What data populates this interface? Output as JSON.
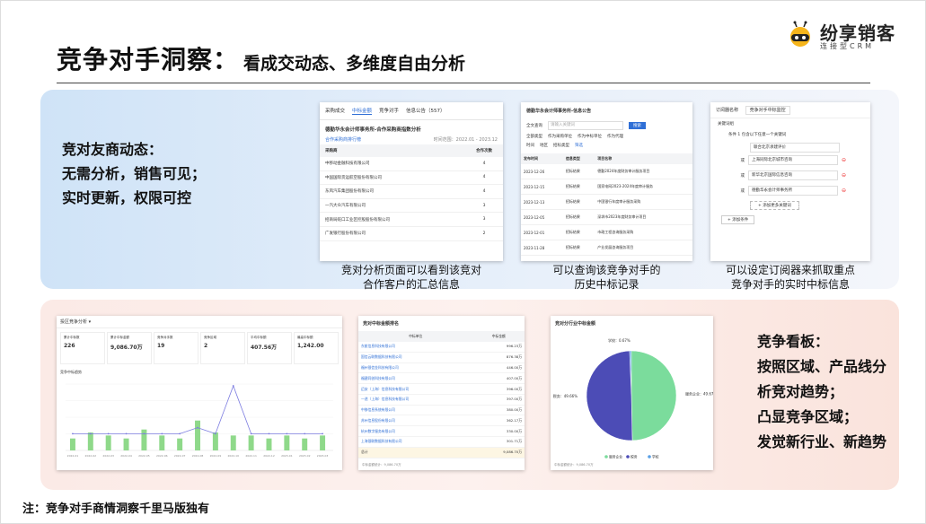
{
  "header": {
    "title": "竞争对手洞察：",
    "subtitle": "看成交动态、多维度自由分析"
  },
  "logo": {
    "name": "纷享销客",
    "tagline": "连接型CRM",
    "icon": "bee-logo-icon"
  },
  "top_section": {
    "blurb": [
      "竞对友商动态：",
      "无需分析，销售可见；",
      "实时更新，权限可控"
    ],
    "captions": [
      [
        "竞对分析页面可以看到该竞对",
        "合作客户的汇总信息"
      ],
      [
        "可以查询该竞争对手的",
        "历史中标记录"
      ],
      [
        "可以设定订阅器来抓取重点",
        "竞争对手的实时中标信息"
      ]
    ]
  },
  "bottom_section": {
    "blurb": [
      "竞争看板：",
      "按照区域、产品线分",
      "析竞对趋势；",
      "凸显竞争区域；",
      "发觉新行业、新趋势"
    ]
  },
  "footer_note": "注：竞争对手商情洞察千里马版独有",
  "shot1": {
    "tabs": [
      "采购成交",
      "中标金额",
      "竞争对手",
      "信息公告（557）"
    ],
    "active_tab": 1,
    "heading": "德勤华永会计师事务所-合作采购商指数分析",
    "subhead_left": "合作采购商排行榜",
    "subhead_right": "时间范围：2022.01 - 2023.12",
    "columns": [
      "采购商",
      "合作次数"
    ],
    "rows": [
      [
        "中移动金融科技有限公司",
        "4"
      ],
      [
        "中国国际货运航空股份有限公司",
        "4"
      ],
      [
        "东风汽车集团股份有限公司",
        "4"
      ],
      [
        "一汽大众汽车有限公司",
        "3"
      ],
      [
        "招商局蛇口工业区控股股份有限公司",
        "3"
      ],
      [
        "广发银行股份有限公司",
        "2"
      ]
    ]
  },
  "shot2": {
    "heading": "德勤华永会计师事务所-信息公告",
    "search_label": "全文查询",
    "search_placeholder": "请输入关键词",
    "search_button": "搜索",
    "filters": [
      "全部类型",
      "作为采购单位",
      "作为中标单位",
      "作为代理"
    ],
    "filters2": [
      "时间",
      "地区",
      "招标类型",
      "筛选"
    ],
    "columns": [
      "发布时间",
      "信息类型",
      "项目名称"
    ],
    "rows": [
      [
        "2023-12-26",
        "招标结果",
        "德勤2024年度财务审计服务项目"
      ],
      [
        "2023-12-15",
        "招标结果",
        "国家电网2023-2024年度审计服务"
      ],
      [
        "2023-12-13",
        "招标结果",
        "中国银行年度审计服务采购"
      ],
      [
        "2023-12-05",
        "招标结果",
        "深圳市2023年度财务审计项目"
      ],
      [
        "2023-12-01",
        "招标结果",
        "市政工程咨询服务采购"
      ],
      [
        "2023-11-28",
        "招标结果",
        "产业发展咨询服务项目"
      ]
    ]
  },
  "shot3": {
    "heading": "订阅器名称",
    "heading_value": "竞争对手中标监控",
    "line1": "关键词组",
    "line2": "条件 1 包含以下任意一个关键词",
    "inputs": [
      "联合北京承建评价",
      "上海同际北京城市咨询",
      "新华北京国际信息咨询",
      "德勤华永会计师事务所"
    ],
    "or_label": "或",
    "add_group": "添加更多关键词",
    "add_condition": "添加条件"
  },
  "shot4": {
    "title": "投区竞争分析",
    "kpis": [
      {
        "label": "累计中标数",
        "value": "226"
      },
      {
        "label": "累计中标金额",
        "value": "9,086.70万"
      },
      {
        "label": "竞争对手数",
        "value": "19"
      },
      {
        "label": "竞争区域",
        "value": "2"
      },
      {
        "label": "平均中标额",
        "value": "407.56万"
      },
      {
        "label": "最高中标额",
        "value": "1,242.00"
      }
    ],
    "chart_title": "竞争中标趋势"
  },
  "shot5": {
    "title": "竞对中标金额排名",
    "columns": [
      "中标单位",
      "中标金额"
    ],
    "rows": [
      [
        "东航信息科技有限公司",
        "996.23万"
      ],
      [
        "国信云联数据科技有限公司",
        "876.38万"
      ],
      [
        "福州银信金科技有限公司",
        "446.00万"
      ],
      [
        "福建同创科技有限公司",
        "407.00万"
      ],
      [
        "迈安（上海）信息科技有限公司",
        "396.00万"
      ],
      [
        "一途（上海）信息科技有限公司",
        "397.00万"
      ],
      [
        "中移信息系统有限公司",
        "380.00万"
      ],
      [
        "苏州信息股份有限公司",
        "362.17万"
      ],
      [
        "杭州数字服务有限公司",
        "330.00万"
      ],
      [
        "上海银联数据科技有限公司",
        "301.71万"
      ]
    ],
    "total_label": "总计",
    "total_value": "9,086.70万",
    "footer": "中标金额统计：9,086.70万"
  },
  "shot6": {
    "title": "竞对分行业中标金额",
    "footer": "中标金额统计：9,086.70万",
    "legend": [
      "服务企业",
      "税务",
      "学校"
    ]
  },
  "chart_data": [
    {
      "type": "pie",
      "title": "竞对分行业中标金额",
      "categories": [
        "服务企业",
        "税务",
        "学校"
      ],
      "values": [
        49.67,
        49.66,
        0.67
      ],
      "labels": [
        "服务企业：49.67%",
        "税务：49.66%",
        "学校：0.67%"
      ],
      "colors": [
        "#7bdc9c",
        "#4c4cb6",
        "#5aa0e6"
      ]
    },
    {
      "type": "bar",
      "title": "竞争中标趋势",
      "categories": [
        "2022-01",
        "2022-02",
        "2022-03",
        "2022-04",
        "2022-05",
        "2022-06",
        "2022-07",
        "2022-08",
        "2022-09",
        "2022-10",
        "2022-11",
        "2022-12",
        "2023-01",
        "2023-02",
        "2023-03"
      ],
      "series": [
        {
          "values": [
            4,
            6,
            5,
            4,
            7,
            5,
            4,
            10,
            6,
            5,
            5,
            4,
            5,
            4,
            5
          ]
        },
        {
          "values": [
            1,
            1,
            1,
            1,
            1,
            1,
            1,
            2,
            1,
            9,
            1,
            1,
            1,
            1,
            1
          ]
        }
      ]
    }
  ]
}
